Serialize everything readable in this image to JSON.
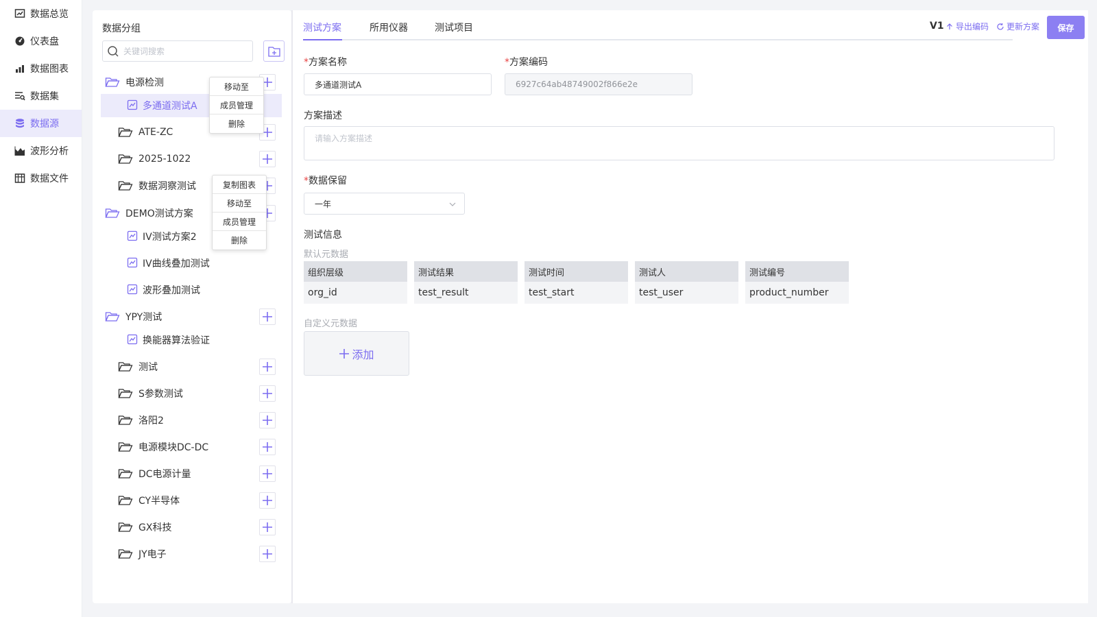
{
  "nav": {
    "items": [
      {
        "label": "数据总览",
        "icon": "overview-icon"
      },
      {
        "label": "仪表盘",
        "icon": "dashboard-icon"
      },
      {
        "label": "数据图表",
        "icon": "bar-chart-icon"
      },
      {
        "label": "数据集",
        "icon": "dataset-icon"
      },
      {
        "label": "数据源",
        "icon": "database-icon"
      },
      {
        "label": "波形分析",
        "icon": "waveform-icon"
      },
      {
        "label": "数据文件",
        "icon": "files-icon"
      }
    ],
    "active_index": 4
  },
  "left_panel": {
    "title": "数据分组",
    "search_placeholder": "关键词搜索",
    "tree": [
      {
        "label": "电源检测",
        "type": "folder",
        "level": 0
      },
      {
        "label": "多通道测试A",
        "type": "chart",
        "level": 1,
        "selected": true
      },
      {
        "label": "ATE-ZC",
        "type": "folder",
        "level": 1
      },
      {
        "label": "2025-1022",
        "type": "folder",
        "level": 1
      },
      {
        "label": "数据洞察测试",
        "type": "folder",
        "level": 1
      },
      {
        "label": "DEMO测试方案",
        "type": "folder",
        "level": 0
      },
      {
        "label": "IV测试方案2",
        "type": "chart",
        "level": 1
      },
      {
        "label": "IV曲线叠加测试",
        "type": "chart",
        "level": 1
      },
      {
        "label": "波形叠加测试",
        "type": "chart",
        "level": 1
      },
      {
        "label": "YPY测试",
        "type": "folder",
        "level": 0
      },
      {
        "label": "换能器算法验证",
        "type": "chart",
        "level": 1
      },
      {
        "label": "测试",
        "type": "folder",
        "level": 1
      },
      {
        "label": "S参数测试",
        "type": "folder",
        "level": 1
      },
      {
        "label": "洛阳2",
        "type": "folder",
        "level": 1
      },
      {
        "label": "电源模块DC-DC",
        "type": "folder",
        "level": 1
      },
      {
        "label": "DC电源计量",
        "type": "folder",
        "level": 1
      },
      {
        "label": "CY半导体",
        "type": "folder",
        "level": 1
      },
      {
        "label": "GX科技",
        "type": "folder",
        "level": 1
      },
      {
        "label": "JY电子",
        "type": "folder",
        "level": 1
      }
    ],
    "context_menu_1": [
      "移动至",
      "成员管理",
      "删除"
    ],
    "context_menu_2": [
      "复制图表",
      "移动至",
      "成员管理",
      "删除"
    ]
  },
  "main": {
    "tabs": [
      "测试方案",
      "所用仪器",
      "测试项目"
    ],
    "active_tab": 0,
    "version": "V1",
    "export_label": "导出编码",
    "update_label": "更新方案",
    "save_label": "保存",
    "form": {
      "req_mark": "*",
      "name_label": "方案名称",
      "name_value": "多通道测试A",
      "code_label": "方案编码",
      "code_value": "6927c64ab48749002f866e2e",
      "desc_label": "方案描述",
      "desc_placeholder": "请输入方案描述",
      "retention_label": "数据保留",
      "retention_value": "一年"
    },
    "test_info_label": "测试信息",
    "default_meta_label": "默认元数据",
    "default_meta": [
      {
        "header": "组织层级",
        "value": "org_id"
      },
      {
        "header": "测试结果",
        "value": "test_result"
      },
      {
        "header": "测试时间",
        "value": "test_start"
      },
      {
        "header": "测试人",
        "value": "test_user"
      },
      {
        "header": "测试编号",
        "value": "product_number"
      }
    ],
    "custom_meta_label": "自定义元数据",
    "add_label": "添加"
  },
  "colors": {
    "accent": "#7b6cf0",
    "required": "#e84343"
  }
}
